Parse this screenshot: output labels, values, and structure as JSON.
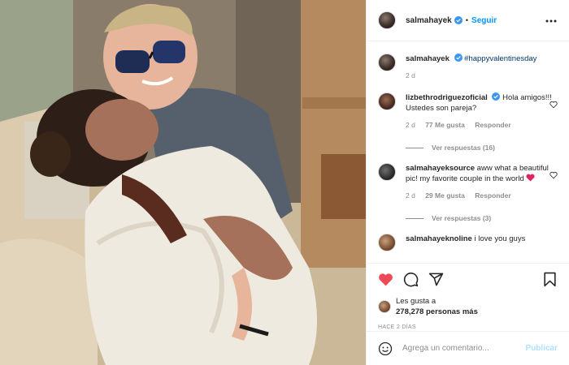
{
  "post": {
    "author": "salmahayek",
    "follow_label": "Seguir",
    "caption": {
      "user": "salmahayek",
      "hashtag": "#happyvalentinesday",
      "time": "2 d"
    },
    "comments": [
      {
        "user": "lizbethrodriguezoficial",
        "text": "Hola amigos!!! Ustedes son pareja?",
        "time": "2 d",
        "likes": "77 Me gusta",
        "reply_label": "Responder",
        "view_replies": "Ver respuestas (16)"
      },
      {
        "user": "salmahayeksource",
        "text": "aww what a beautiful pic! my favorite couple in the world",
        "time": "2 d",
        "likes": "29 Me gusta",
        "reply_label": "Responder",
        "view_replies": "Ver respuestas (3)"
      },
      {
        "user": "salmahayeknoline",
        "text": "i love you guys"
      }
    ],
    "likes_prefix": "Les gusta a",
    "likes_count": "278,278 personas más",
    "posted_ago": "HACE 2 DÍAS",
    "comment_placeholder": "Agrega un comentario...",
    "publish_label": "Publicar"
  },
  "icons": {
    "verified": "verified-badge-icon",
    "like": "heart-filled-icon",
    "comment": "comment-bubble-icon",
    "share": "paper-plane-icon",
    "save": "bookmark-icon",
    "emoji": "smiley-icon",
    "options": "more-options-icon"
  },
  "colors": {
    "accent": "#0095f6",
    "like": "#ed4956",
    "muted": "#8e8e8e",
    "publish_disabled": "#b2dffc",
    "hashtag": "#00376b"
  }
}
